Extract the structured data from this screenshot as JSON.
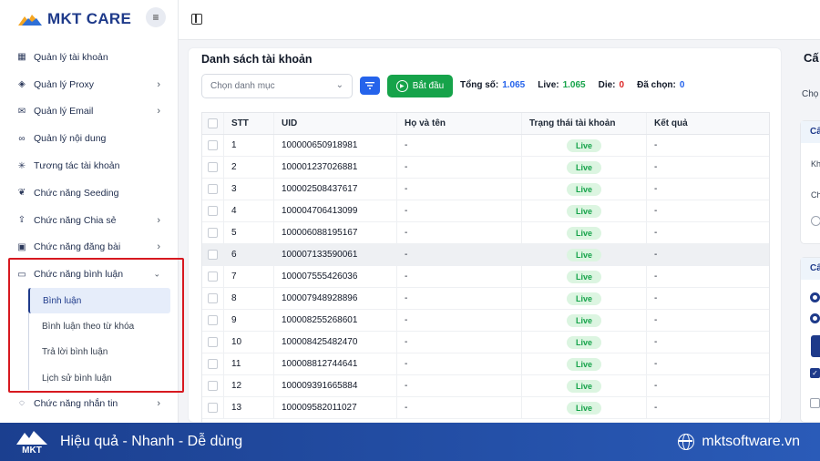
{
  "app": {
    "brand": "MKT CARE"
  },
  "sidebar": {
    "items": [
      {
        "label": "Quản lý tài khoản",
        "icon": "grid-icon",
        "chevron": false
      },
      {
        "label": "Quản lý Proxy",
        "icon": "layers-icon",
        "chevron": true
      },
      {
        "label": "Quản lý Email",
        "icon": "mail-icon",
        "chevron": true
      },
      {
        "label": "Quản lý nội dung",
        "icon": "link-icon",
        "chevron": false
      },
      {
        "label": "Tương tác tài khoản",
        "icon": "sparkle-icon",
        "chevron": false
      },
      {
        "label": "Chức năng Seeding",
        "icon": "sprout-icon",
        "chevron": false
      },
      {
        "label": "Chức năng Chia sẻ",
        "icon": "share-icon",
        "chevron": true
      },
      {
        "label": "Chức năng đăng bài",
        "icon": "image-icon",
        "chevron": true
      },
      {
        "label": "Chức năng bình luận",
        "icon": "comment-icon",
        "chevron": "down"
      },
      {
        "label": "Chức năng nhắn tin",
        "icon": "chat-icon",
        "chevron": true
      }
    ],
    "submenu": [
      {
        "label": "Bình luận",
        "active": true
      },
      {
        "label": "Bình luận theo từ khóa",
        "active": false
      },
      {
        "label": "Trả lời bình luận",
        "active": false
      },
      {
        "label": "Lịch sử bình luận",
        "active": false
      }
    ]
  },
  "main": {
    "title": "Danh sách tài khoản",
    "category_placeholder": "Chọn danh mục",
    "start_label": "Bắt đầu",
    "stats": {
      "total_label": "Tổng số:",
      "total_value": "1.065",
      "live_label": "Live:",
      "live_value": "1.065",
      "die_label": "Die:",
      "die_value": "0",
      "selected_label": "Đã chọn:",
      "selected_value": "0"
    },
    "columns": [
      "STT",
      "UID",
      "Họ và tên",
      "Trạng thái tài khoản",
      "Kết quả"
    ],
    "rows": [
      {
        "stt": "1",
        "uid": "100000650918981",
        "name": "-",
        "status": "Live",
        "result": "-"
      },
      {
        "stt": "2",
        "uid": "100001237026881",
        "name": "-",
        "status": "Live",
        "result": "-"
      },
      {
        "stt": "3",
        "uid": "100002508437617",
        "name": "-",
        "status": "Live",
        "result": "-"
      },
      {
        "stt": "4",
        "uid": "100004706413099",
        "name": "-",
        "status": "Live",
        "result": "-"
      },
      {
        "stt": "5",
        "uid": "100006088195167",
        "name": "-",
        "status": "Live",
        "result": "-"
      },
      {
        "stt": "6",
        "uid": "100007133590061",
        "name": "-",
        "status": "Live",
        "result": "-"
      },
      {
        "stt": "7",
        "uid": "100007555426036",
        "name": "-",
        "status": "Live",
        "result": "-"
      },
      {
        "stt": "8",
        "uid": "100007948928896",
        "name": "-",
        "status": "Live",
        "result": "-"
      },
      {
        "stt": "9",
        "uid": "100008255268601",
        "name": "-",
        "status": "Live",
        "result": "-"
      },
      {
        "stt": "10",
        "uid": "100008425482470",
        "name": "-",
        "status": "Live",
        "result": "-"
      },
      {
        "stt": "11",
        "uid": "100008812744641",
        "name": "-",
        "status": "Live",
        "result": "-"
      },
      {
        "stt": "12",
        "uid": "100009391665884",
        "name": "-",
        "status": "Live",
        "result": "-"
      },
      {
        "stt": "13",
        "uid": "100009582011027",
        "name": "-",
        "status": "Live",
        "result": "-"
      }
    ]
  },
  "right_panel": {
    "title": "Cấ",
    "label": "Chọ",
    "section1_title": "Cấ",
    "section1_a": "Kh",
    "section1_b": "Ch",
    "section2_title": "Cấ"
  },
  "footer": {
    "logo_text": "MKT",
    "tagline": "Hiệu quả - Nhanh - Dễ dùng",
    "website": "mktsoftware.vn"
  },
  "colors": {
    "brand_navy": "#1e3a8a",
    "start_green": "#16a34a",
    "filter_blue": "#2563eb",
    "highlight_red": "#d71920",
    "live_value": "#16a34a",
    "die_value": "#dc2626",
    "total_value": "#2563eb",
    "selected_value": "#2563eb"
  }
}
